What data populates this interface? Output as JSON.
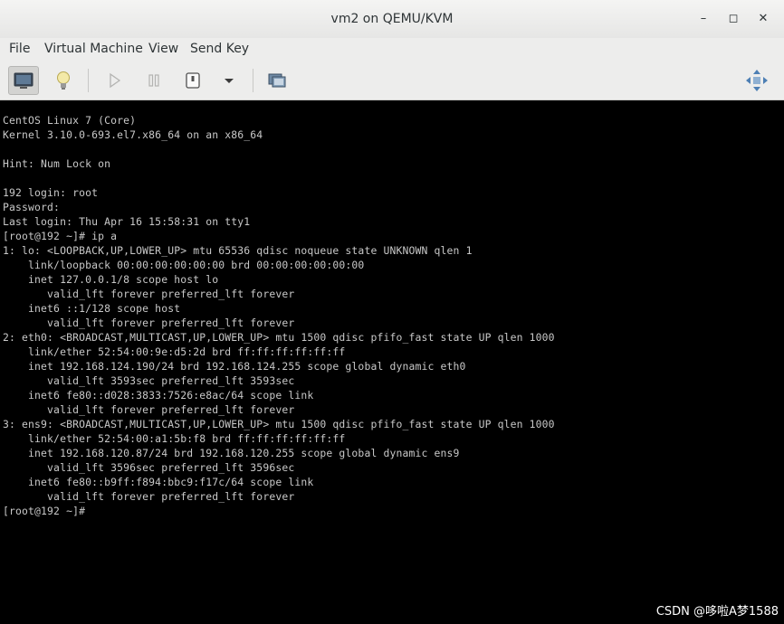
{
  "window": {
    "title": "vm2 on QEMU/KVM",
    "controls": {
      "minimize": "–",
      "maximize": "◻",
      "close": "✕"
    }
  },
  "menu": [
    "File",
    "Virtual Machine",
    "View",
    "Send Key"
  ],
  "toolbar": {
    "buttons": [
      {
        "name": "console-view-button",
        "icon": "monitor-icon",
        "active": true
      },
      {
        "name": "details-view-button",
        "icon": "lightbulb-icon",
        "active": false
      },
      {
        "name": "run-button",
        "icon": "play-icon",
        "active": false,
        "enabled": false
      },
      {
        "name": "pause-button",
        "icon": "pause-icon",
        "active": false,
        "enabled": false
      },
      {
        "name": "shutdown-button",
        "icon": "power-icon",
        "active": false
      },
      {
        "name": "shutdown-dropdown",
        "icon": "chevron-down-icon",
        "active": false
      },
      {
        "name": "snapshots-button",
        "icon": "snapshots-icon",
        "active": false
      },
      {
        "name": "fullscreen-button",
        "icon": "move-icon",
        "active": false
      }
    ]
  },
  "console": {
    "lines": [
      "CentOS Linux 7 (Core)",
      "Kernel 3.10.0-693.el7.x86_64 on an x86_64",
      "",
      "Hint: Num Lock on",
      "",
      "192 login: root",
      "Password:",
      "Last login: Thu Apr 16 15:58:31 on tty1",
      "[root@192 ~]# ip a",
      "1: lo: <LOOPBACK,UP,LOWER_UP> mtu 65536 qdisc noqueue state UNKNOWN qlen 1",
      "    link/loopback 00:00:00:00:00:00 brd 00:00:00:00:00:00",
      "    inet 127.0.0.1/8 scope host lo",
      "       valid_lft forever preferred_lft forever",
      "    inet6 ::1/128 scope host",
      "       valid_lft forever preferred_lft forever",
      "2: eth0: <BROADCAST,MULTICAST,UP,LOWER_UP> mtu 1500 qdisc pfifo_fast state UP qlen 1000",
      "    link/ether 52:54:00:9e:d5:2d brd ff:ff:ff:ff:ff:ff",
      "    inet 192.168.124.190/24 brd 192.168.124.255 scope global dynamic eth0",
      "       valid_lft 3593sec preferred_lft 3593sec",
      "    inet6 fe80::d028:3833:7526:e8ac/64 scope link",
      "       valid_lft forever preferred_lft forever",
      "3: ens9: <BROADCAST,MULTICAST,UP,LOWER_UP> mtu 1500 qdisc pfifo_fast state UP qlen 1000",
      "    link/ether 52:54:00:a1:5b:f8 brd ff:ff:ff:ff:ff:ff",
      "    inet 192.168.120.87/24 brd 192.168.120.255 scope global dynamic ens9",
      "       valid_lft 3596sec preferred_lft 3596sec",
      "    inet6 fe80::b9ff:f894:bbc9:f17c/64 scope link",
      "       valid_lft forever preferred_lft forever",
      "[root@192 ~]#"
    ]
  },
  "watermark": "CSDN @哆啦A梦1588"
}
